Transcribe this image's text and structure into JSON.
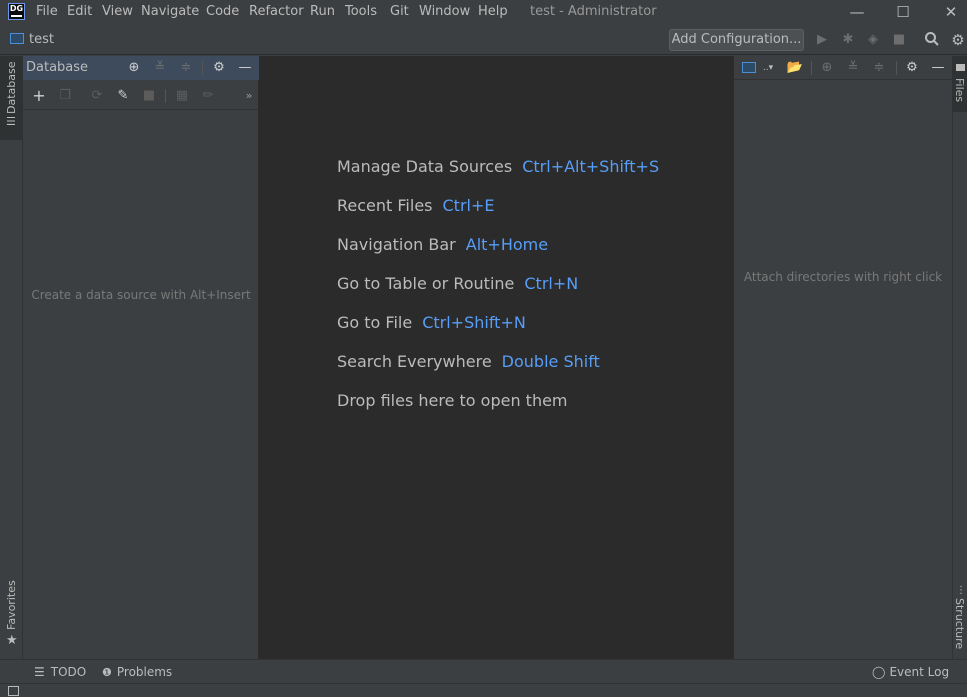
{
  "app": {
    "logo_text": "DG",
    "window_title": "test - Administrator"
  },
  "menu": [
    "File",
    "Edit",
    "View",
    "Navigate",
    "Code",
    "Refactor",
    "Run",
    "Tools",
    "Git",
    "Window",
    "Help"
  ],
  "window_controls": {
    "minimize": "—",
    "maximize": "☐",
    "close": "✕"
  },
  "navbar": {
    "project_name": "test",
    "add_configuration_label": "Add Configuration..."
  },
  "left_stripe": {
    "database_tab": "Database",
    "favorites_tab": "Favorites"
  },
  "database_panel": {
    "title": "Database",
    "empty_text": "Create a data source with Alt+Insert"
  },
  "editor": {
    "hints": [
      {
        "action": "Manage Data Sources",
        "shortcut": "Ctrl+Alt+Shift+S"
      },
      {
        "action": "Recent Files",
        "shortcut": "Ctrl+E"
      },
      {
        "action": "Navigation Bar",
        "shortcut": "Alt+Home"
      },
      {
        "action": "Go to Table or Routine",
        "shortcut": "Ctrl+N"
      },
      {
        "action": "Go to File",
        "shortcut": "Ctrl+Shift+N"
      },
      {
        "action": "Search Everywhere",
        "shortcut": "Double Shift"
      },
      {
        "action": "Drop files here to open them",
        "shortcut": ""
      }
    ]
  },
  "files_panel": {
    "empty_text": "Attach directories with right click"
  },
  "right_stripe": {
    "files_tab": "Files",
    "structure_tab": "Structure"
  },
  "bottom_bar": {
    "todo": "TODO",
    "problems": "Problems",
    "event_log": "Event Log"
  },
  "colors": {
    "accent": "#589df6",
    "editor_bg": "#2b2b2b",
    "panel_bg": "#3c3f41",
    "panel_header_active": "#3d4b5c"
  }
}
